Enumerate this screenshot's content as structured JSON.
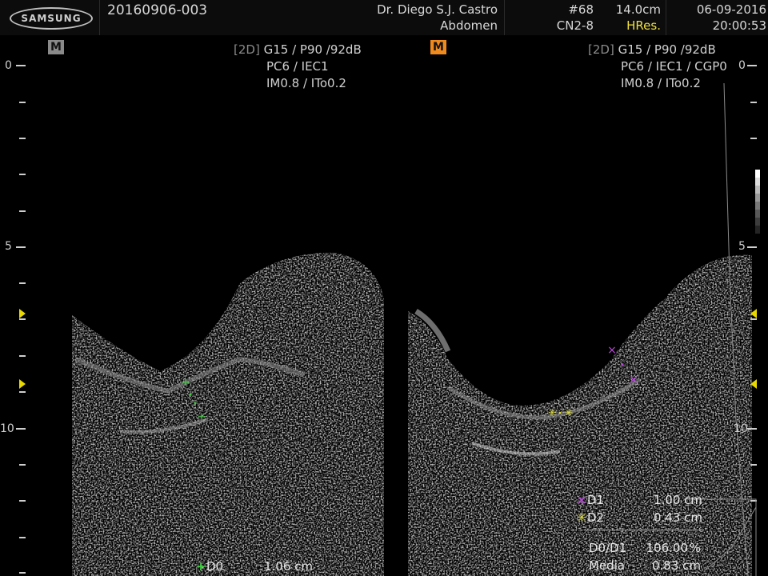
{
  "header": {
    "brand_logo": "SAMSUNG",
    "patient_id": "20160906-003",
    "physician": "Dr. Diego S.J. Castro",
    "exam": "Abdomen",
    "frame_number": "#68",
    "probe": "CN2-8",
    "depth": "14.0cm",
    "mode": "HRes.",
    "date": "06-09-2016",
    "time": "20:00:53"
  },
  "left_panel": {
    "marker": "M",
    "mode_tag": "[2D]",
    "line1": "G15 / P90 /92dB",
    "line2": "PC6 / IEC1",
    "line3": "IM0.8 / ITo0.2"
  },
  "right_panel": {
    "marker": "M",
    "mode_tag": "[2D]",
    "line1": "G15 / P90 /92dB",
    "line2": "PC6 / IEC1 / CGP0",
    "line3": "IM0.8 / ITo0.2"
  },
  "depth_scale": [
    "0",
    "5",
    "10"
  ],
  "measurements": {
    "d0": {
      "glyph": "+",
      "label": "D0",
      "value": "1.06 cm",
      "color": "#3ecf3e"
    },
    "d1": {
      "glyph": "×",
      "label": "D1",
      "value": "1.00 cm",
      "color": "#b84ad8"
    },
    "d2": {
      "glyph": "✳",
      "label": "D2",
      "value": "0.43 cm",
      "color": "#e0e040"
    },
    "ratio": {
      "label": "D0/D1",
      "value": "106.00",
      "unit": "%"
    },
    "mean": {
      "label": "Media",
      "value": "0.83 cm"
    }
  },
  "colors": {
    "accent_orange": "#f08a1c",
    "focus_marker": "#e8d800",
    "highlight_yellow": "#f0e040"
  }
}
